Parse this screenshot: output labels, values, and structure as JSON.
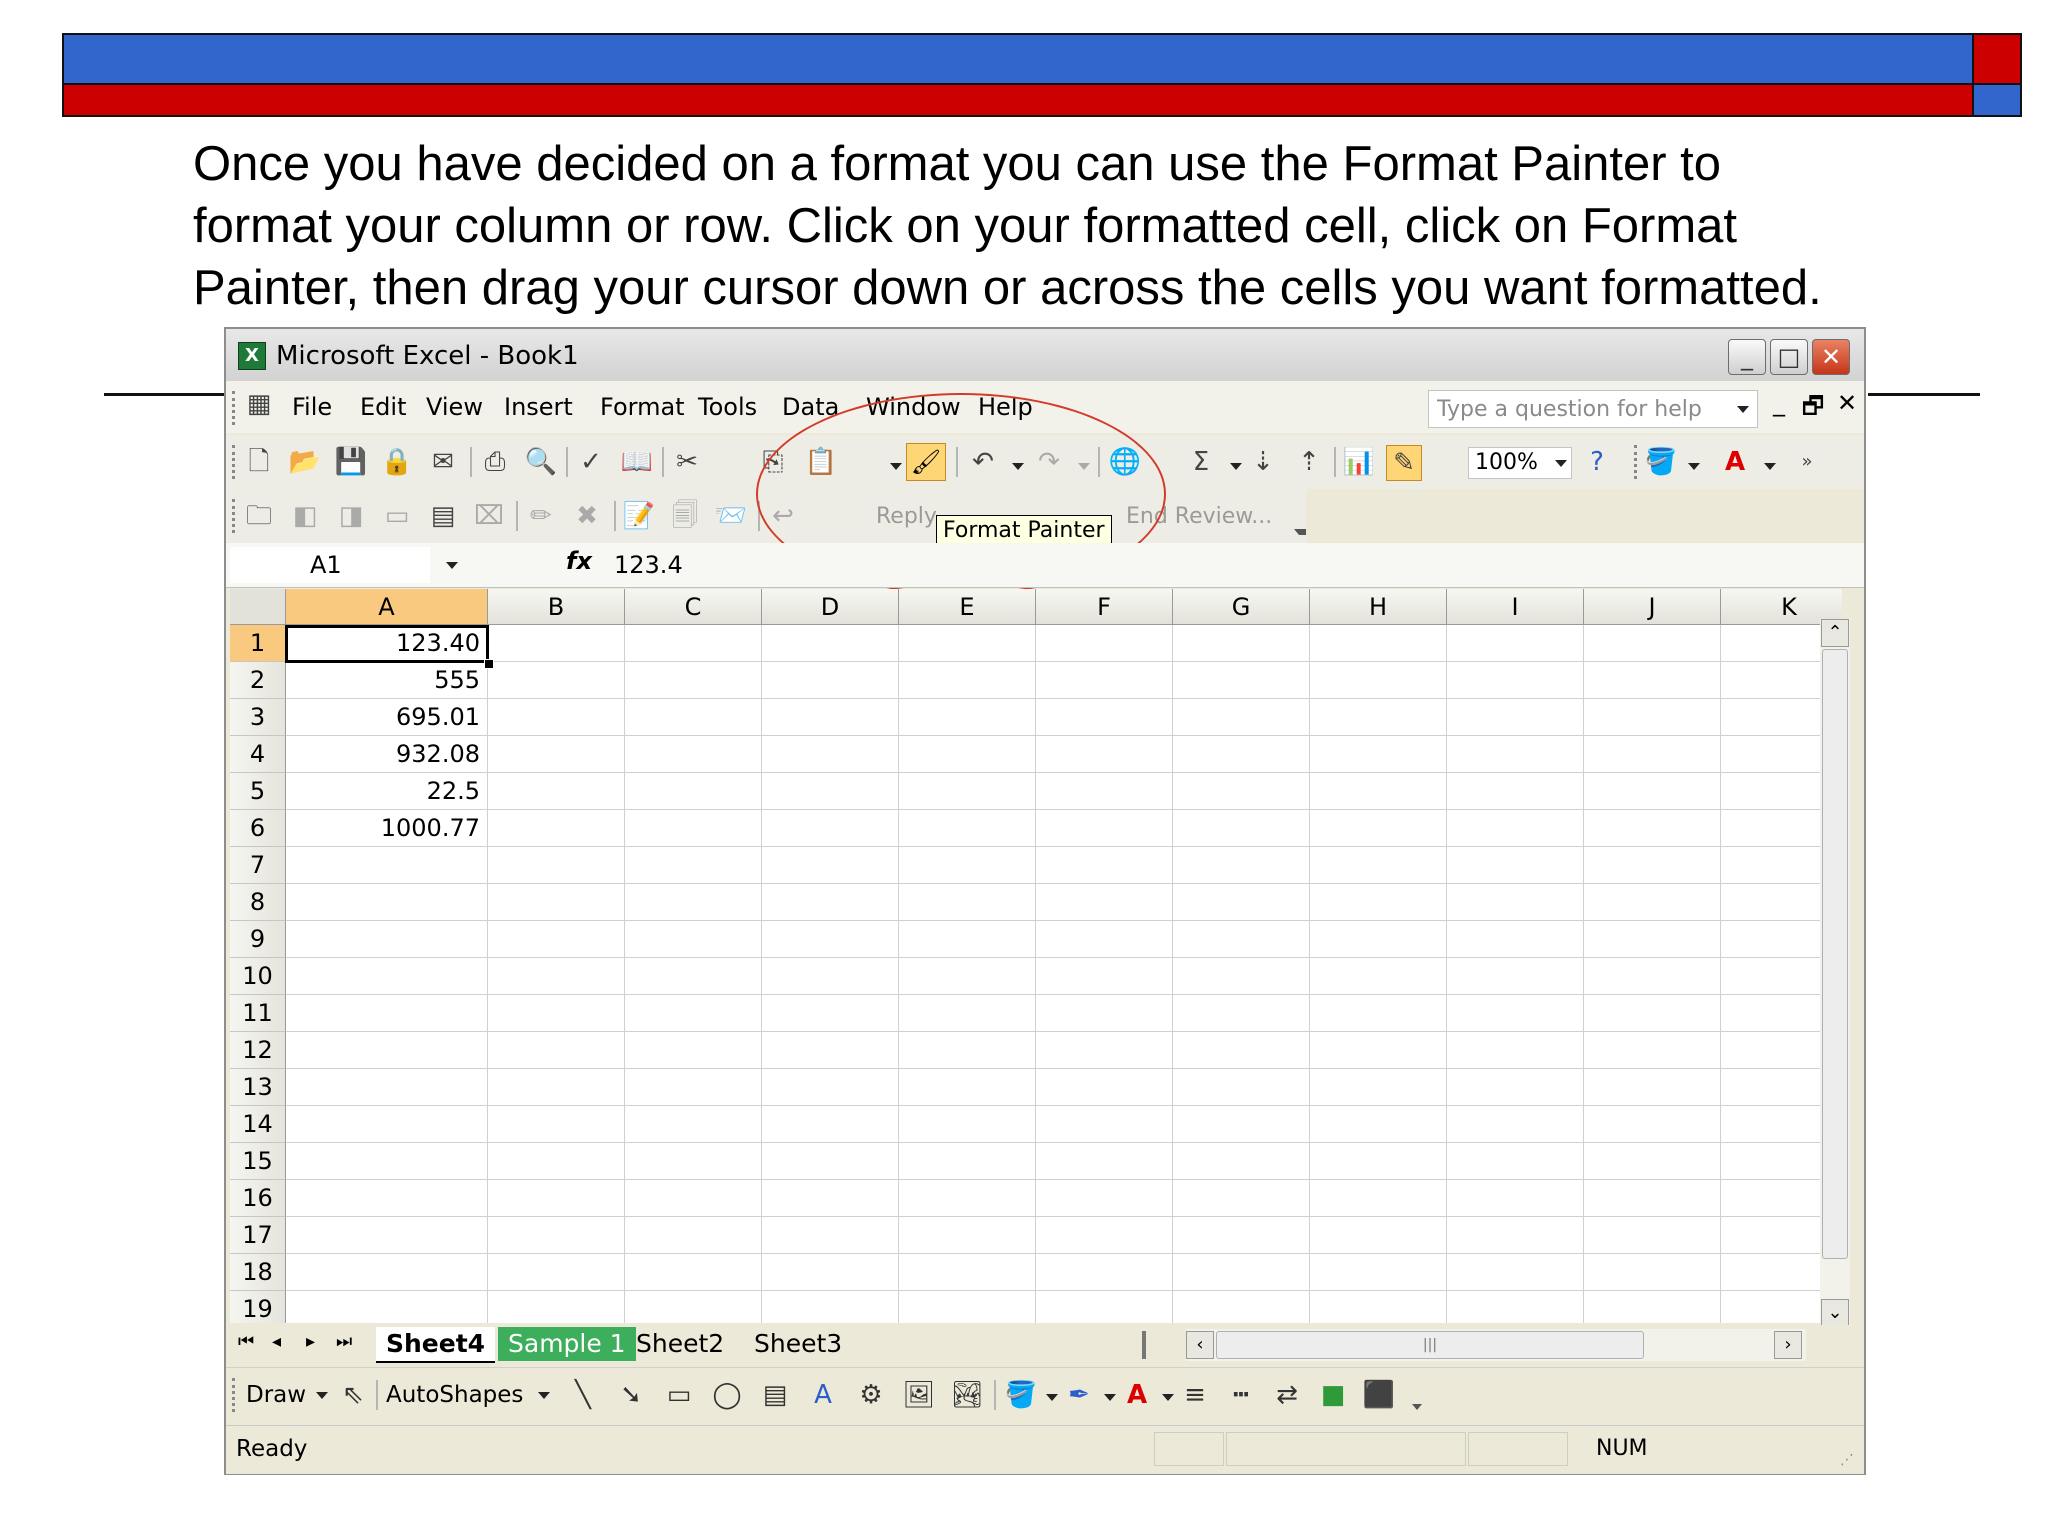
{
  "instructions": {
    "line1": "Once you have decided on a format you can use the Format Painter to",
    "line2": "format your column or row.  Click on your formatted cell, click on Format",
    "line3": "Painter, then drag your cursor down or across the cells you want formatted."
  },
  "window": {
    "title": "Microsoft Excel - Book1",
    "minimize": "_",
    "maximize": "□",
    "close": "✕"
  },
  "menu": {
    "items": [
      "File",
      "Edit",
      "View",
      "Insert",
      "Format",
      "Tools",
      "Data",
      "Window",
      "Help"
    ],
    "help_placeholder": "Type a question for help",
    "doc_minimize": "_",
    "doc_restore": "🗗",
    "doc_close": "✕"
  },
  "toolbar": {
    "zoom": "100%",
    "sigma": "Σ",
    "reply": "Reply",
    "end_review": "End Review...",
    "tooltip": "Format Painter"
  },
  "formula_bar": {
    "name_box": "A1",
    "fx": "fx",
    "value": "123.4"
  },
  "grid": {
    "columns": [
      "A",
      "B",
      "C",
      "D",
      "E",
      "F",
      "G",
      "H",
      "I",
      "J",
      "K"
    ],
    "rows": [
      "1",
      "2",
      "3",
      "4",
      "5",
      "6",
      "7",
      "8",
      "9",
      "10",
      "11",
      "12",
      "13",
      "14",
      "15",
      "16",
      "17",
      "18",
      "19"
    ],
    "cells_A": [
      "123.40",
      "555",
      "695.01",
      "932.08",
      "22.5",
      "1000.77"
    ],
    "selected_cell": "A1"
  },
  "sheet_tabs": [
    "Sheet4",
    "Sample 1",
    "Sheet2",
    "Sheet3"
  ],
  "draw_toolbar": {
    "draw": "Draw",
    "autoshapes": "AutoShapes"
  },
  "status": {
    "ready": "Ready",
    "num": "NUM"
  },
  "colors": {
    "slide_blue": "#3366cc",
    "slide_red": "#cc0000",
    "highlight_oval": "#d23c2a",
    "selected_header": "#f8c97e",
    "tab_sample1": "#3cae5c"
  }
}
